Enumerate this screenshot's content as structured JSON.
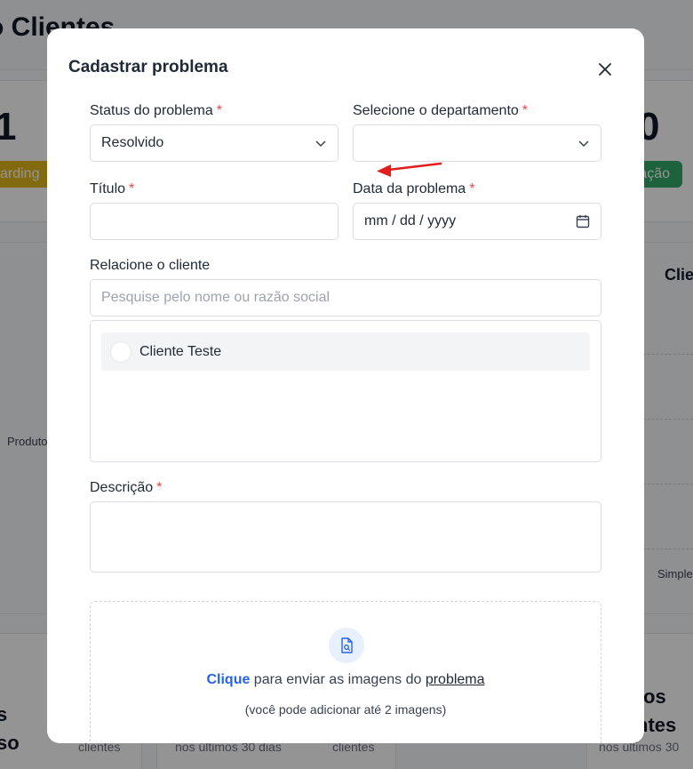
{
  "background": {
    "page_title": "o Clientes",
    "stat_left_number": "1",
    "stat_right_number": "0",
    "badge_left": "arding",
    "badge_right": "ração",
    "chart_label_left": "Produto",
    "chart_header_right": "Clie",
    "legend_right": "Simples",
    "bottom_left_big_1": "s",
    "bottom_left_big_2": "so",
    "bottom_right_big_1": "os",
    "bottom_right_big_2": "ntes",
    "card_sub_1": "clientes",
    "card_sub_2": "nos últimos 30 dias",
    "card_sub_3": "clientes",
    "card_sub_4": "nos últimos 30",
    "colors": {
      "badge_left": "#e3b71b",
      "badge_right": "#2fa96a"
    }
  },
  "modal": {
    "title": "Cadastrar problema",
    "close_icon": "close-icon",
    "status": {
      "label": "Status do problema",
      "required": "*",
      "value": "Resolvido"
    },
    "department": {
      "label": "Selecione o departamento",
      "required": "*",
      "value": ""
    },
    "title_field": {
      "label": "Título",
      "required": "*",
      "value": ""
    },
    "date": {
      "label": "Data da problema",
      "required": "*",
      "value": "mm / dd / yyyy"
    },
    "client": {
      "label": "Relacione o cliente",
      "placeholder": "Pesquise pelo nome ou razão social",
      "options": [
        {
          "label": "Cliente Teste",
          "selected": false
        }
      ]
    },
    "description": {
      "label": "Descrição",
      "required": "*",
      "value": ""
    },
    "upload": {
      "link_text": "Clique",
      "text_middle": " para enviar as imagens do ",
      "text_underline": "problema",
      "hint": "(você pode adicionar até 2 imagens)",
      "icon": "file-search-icon"
    },
    "annotation": {
      "icon": "red-arrow-annotation",
      "color": "#e11d1d"
    }
  }
}
